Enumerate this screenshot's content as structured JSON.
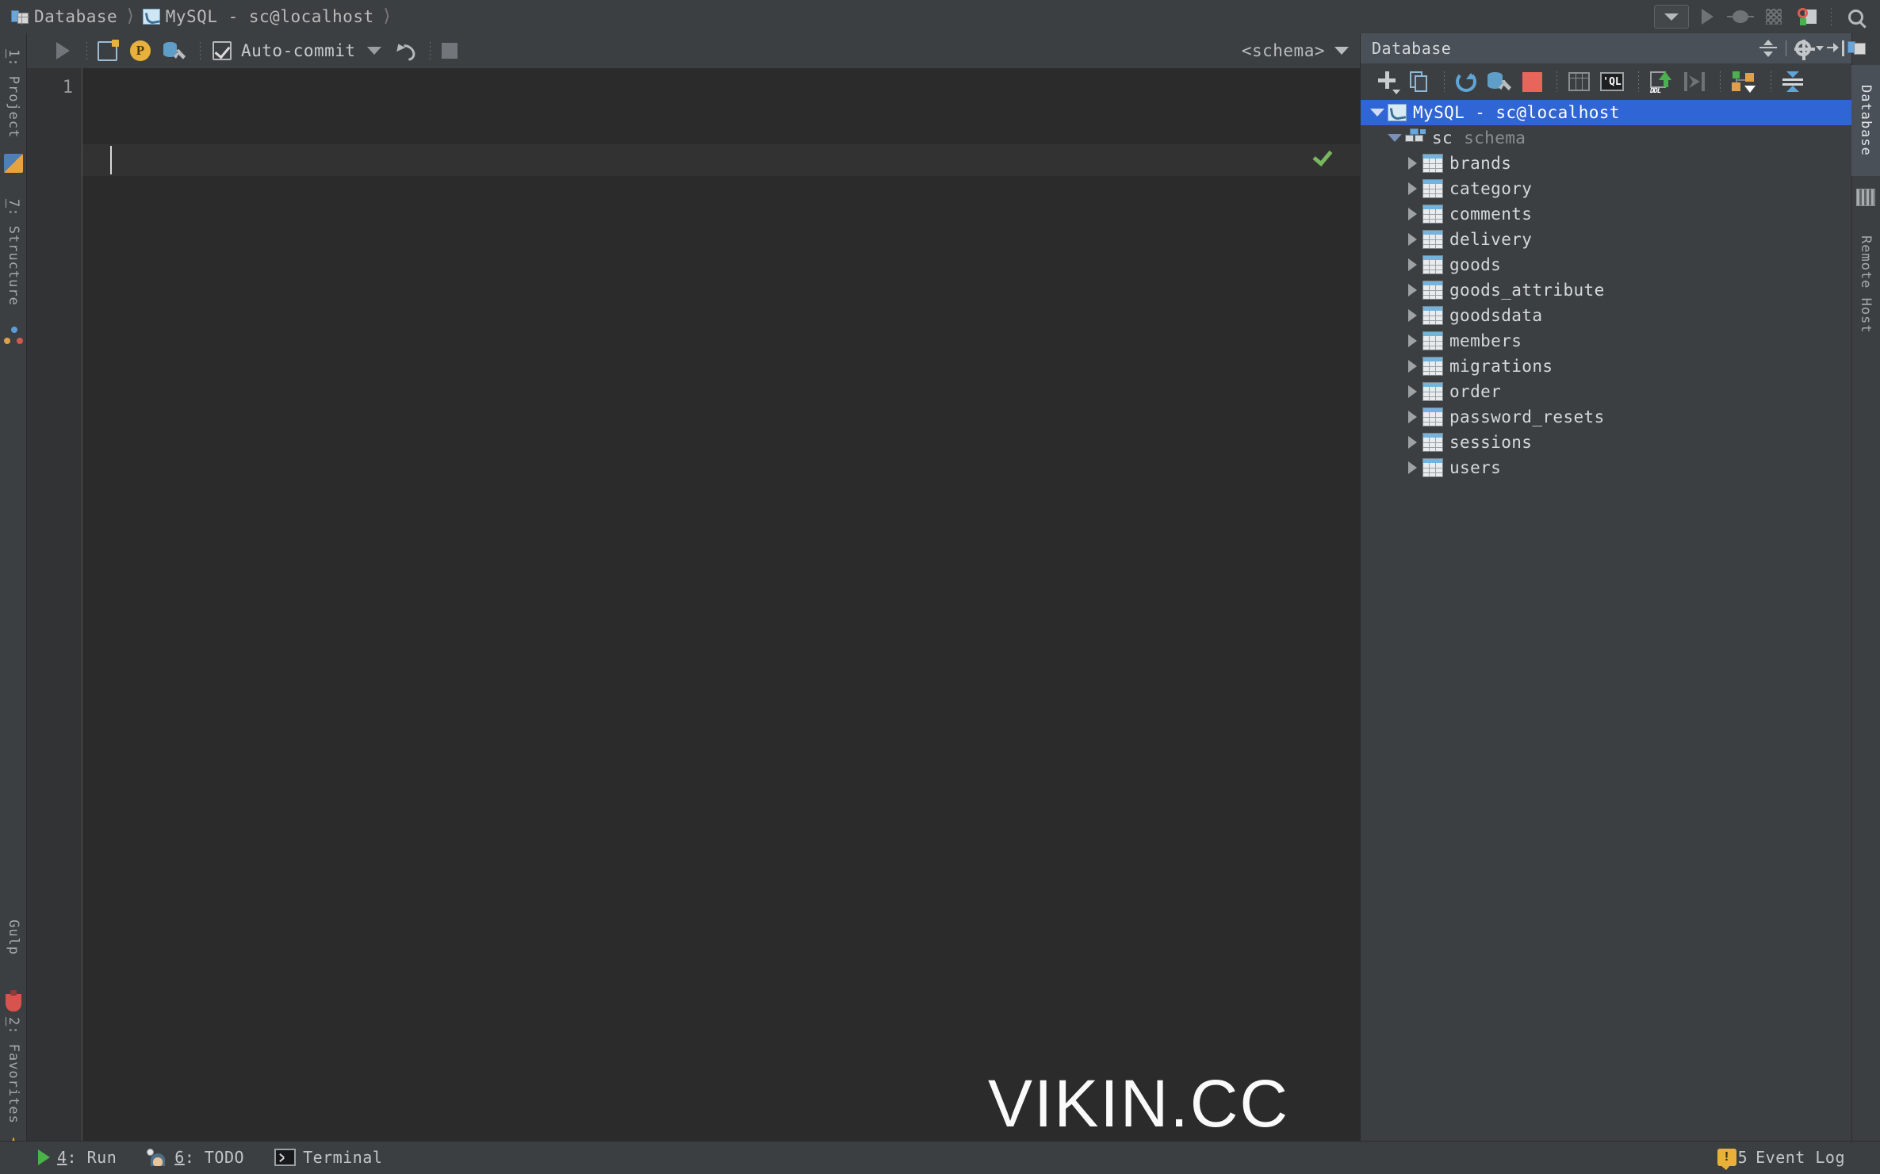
{
  "window": {
    "breadcrumb": [
      {
        "icon": "database-icon",
        "label": "Database"
      },
      {
        "icon": "mysql-icon",
        "label": "MySQL - sc@localhost"
      }
    ]
  },
  "top_toolbar": {
    "buttons": [
      {
        "name": "run-config-dropdown",
        "icon": "chevron-down-icon"
      },
      {
        "name": "run-button",
        "icon": "play-icon"
      },
      {
        "name": "debug-button",
        "icon": "bug-icon"
      },
      {
        "name": "coverage-button",
        "icon": "coverage-icon"
      },
      {
        "name": "stop-button",
        "icon": "stop-process-icon"
      },
      {
        "name": "search-everywhere-button",
        "icon": "search-icon"
      }
    ]
  },
  "editor_toolbar": {
    "execute_label": "",
    "auto_commit_label": "Auto-commit",
    "auto_commit_checked": true,
    "schema_selector": "<schema>",
    "buttons": [
      {
        "name": "execute-button",
        "icon": "play-icon"
      },
      {
        "name": "new-console-button",
        "icon": "new-console-icon"
      },
      {
        "name": "parameters-button",
        "icon": "p-circle-icon"
      },
      {
        "name": "data-source-properties-button",
        "icon": "database-wrench-icon"
      },
      {
        "name": "rollback-button",
        "icon": "undo-icon"
      },
      {
        "name": "stop-query-button",
        "icon": "stop-square-icon"
      }
    ]
  },
  "editor": {
    "line_number": "1",
    "content": "",
    "inspection_status": "ok",
    "watermark": "VIKIN.CC"
  },
  "left_tool_strip": {
    "top_tabs": [
      {
        "name": "sidebar-tab-project",
        "label": "1: Project",
        "underline": "1",
        "icon": "project-icon"
      },
      {
        "name": "sidebar-tab-structure",
        "label": "7: Structure",
        "underline": "7",
        "icon": "structure-icon"
      }
    ],
    "bottom_tabs": [
      {
        "name": "sidebar-tab-gulp",
        "label": "Gulp",
        "icon": "gulp-icon"
      },
      {
        "name": "sidebar-tab-favorites",
        "label": "2: Favorites",
        "underline": "2",
        "icon": "star-icon"
      }
    ]
  },
  "right_tool_strip": {
    "tabs": [
      {
        "name": "sidebar-tab-database",
        "label": "Database",
        "icon": "database-icon",
        "active": true
      },
      {
        "name": "sidebar-tab-remote-host",
        "label": "Remote Host",
        "icon": "remote-host-icon",
        "active": false
      }
    ]
  },
  "database_panel": {
    "title": "Database",
    "header_buttons": [
      {
        "name": "collapse-all-button",
        "icon": "collapse-all-icon"
      },
      {
        "name": "settings-button",
        "icon": "gear-icon"
      },
      {
        "name": "hide-panel-button",
        "icon": "hide-panel-icon"
      }
    ],
    "toolbar_buttons": [
      {
        "name": "add-data-source-button",
        "icon": "plus-dropdown-icon"
      },
      {
        "name": "duplicate-button",
        "icon": "copy-icon"
      },
      {
        "name": "synchronize-button",
        "icon": "refresh-icon"
      },
      {
        "name": "data-source-properties-button",
        "icon": "database-wrench-icon"
      },
      {
        "name": "stop-button",
        "icon": "red-square-icon"
      },
      {
        "name": "jump-to-data-button",
        "icon": "table-grid-icon"
      },
      {
        "name": "open-query-console-button",
        "icon": "ql-console-icon"
      },
      {
        "name": "open-ddl-button",
        "icon": "ddl-upload-icon"
      },
      {
        "name": "compare-button",
        "icon": "compare-icon"
      },
      {
        "name": "diagram-button",
        "icon": "diagram-icon"
      },
      {
        "name": "expand-collapse-button",
        "icon": "expand-all-icon"
      }
    ],
    "tree": {
      "connection": {
        "label": "MySQL - sc@localhost",
        "icon": "mysql-connection-icon",
        "expanded": true,
        "selected": true
      },
      "schema": {
        "label": "sc",
        "sublabel": "schema",
        "icon": "schema-icon",
        "expanded": true
      },
      "tables": [
        {
          "label": "brands",
          "icon": "table-icon",
          "expanded": false
        },
        {
          "label": "category",
          "icon": "table-icon",
          "expanded": false
        },
        {
          "label": "comments",
          "icon": "table-icon",
          "expanded": false
        },
        {
          "label": "delivery",
          "icon": "table-icon",
          "expanded": false
        },
        {
          "label": "goods",
          "icon": "table-icon",
          "expanded": false
        },
        {
          "label": "goods_attribute",
          "icon": "table-icon",
          "expanded": false
        },
        {
          "label": "goodsdata",
          "icon": "table-icon",
          "expanded": false
        },
        {
          "label": "members",
          "icon": "table-icon",
          "expanded": false
        },
        {
          "label": "migrations",
          "icon": "table-icon",
          "expanded": false
        },
        {
          "label": "order",
          "icon": "table-icon",
          "expanded": false
        },
        {
          "label": "password_resets",
          "icon": "table-icon",
          "expanded": false
        },
        {
          "label": "sessions",
          "icon": "table-icon",
          "expanded": false
        },
        {
          "label": "users",
          "icon": "table-icon",
          "expanded": false
        }
      ]
    }
  },
  "status_bar": {
    "items": [
      {
        "name": "status-run",
        "label": "4: Run",
        "underline": "4",
        "icon": "play-icon"
      },
      {
        "name": "status-todo",
        "label": "6: TODO",
        "underline": "6",
        "icon": "todo-icon"
      },
      {
        "name": "status-terminal",
        "label": "Terminal",
        "icon": "terminal-icon"
      }
    ],
    "event_log": {
      "count": "5",
      "label": "Event Log",
      "icon": "warning-icon"
    }
  },
  "colors": {
    "selection_blue": "#2f65d5",
    "panel_header": "#4a5058",
    "chrome": "#3c3f41",
    "editor_bg": "#2b2b2b",
    "text": "#d6d9db"
  }
}
